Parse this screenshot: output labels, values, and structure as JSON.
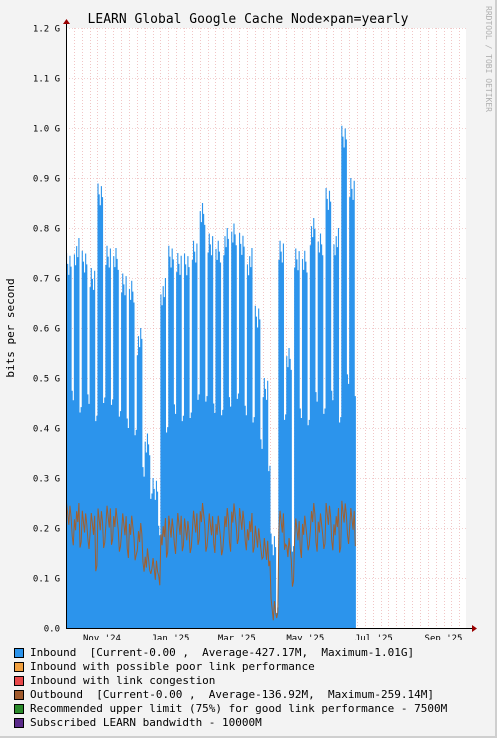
{
  "chart_data": {
    "type": "area",
    "title": "LEARN Global Google Cache Node×pan=yearly",
    "ylabel": "bits per second",
    "watermark": "RRDTOOL / TOBI OETIKER",
    "ylim": [
      0,
      1.2
    ],
    "yunit": "G",
    "y_ticks": [
      {
        "value": 0.0,
        "label": "0.0"
      },
      {
        "value": 0.1,
        "label": "0.1 G"
      },
      {
        "value": 0.2,
        "label": "0.2 G"
      },
      {
        "value": 0.3,
        "label": "0.3 G"
      },
      {
        "value": 0.4,
        "label": "0.4 G"
      },
      {
        "value": 0.5,
        "label": "0.5 G"
      },
      {
        "value": 0.6,
        "label": "0.6 G"
      },
      {
        "value": 0.7,
        "label": "0.7 G"
      },
      {
        "value": 0.8,
        "label": "0.8 G"
      },
      {
        "value": 0.9,
        "label": "0.9 G"
      },
      {
        "value": 1.0,
        "label": "1.0 G"
      },
      {
        "value": 1.1,
        "label": "1.1 G"
      },
      {
        "value": 1.2,
        "label": "1.2 G"
      }
    ],
    "xlim": [
      "2024-10-14",
      "2025-10-05"
    ],
    "x_ticks": [
      {
        "date": "2024-11-15",
        "label": "Nov '24"
      },
      {
        "date": "2025-01-15",
        "label": "Jan '25"
      },
      {
        "date": "2025-03-15",
        "label": "Mar '25"
      },
      {
        "date": "2025-05-15",
        "label": "May '25"
      },
      {
        "date": "2025-07-15",
        "label": "Jul '25"
      },
      {
        "date": "2025-09-15",
        "label": "Sep '25"
      }
    ],
    "inbound_weekly": [
      {
        "week_start": "2024-10-14",
        "weekday_max": 0.75,
        "weekend_min": 0.45
      },
      {
        "week_start": "2024-10-21",
        "weekday_max": 0.78,
        "weekend_min": 0.42
      },
      {
        "week_start": "2024-10-28",
        "weekday_max": 0.76,
        "weekend_min": 0.44
      },
      {
        "week_start": "2024-11-04",
        "weekday_max": 0.72,
        "weekend_min": 0.4
      },
      {
        "week_start": "2024-11-11",
        "weekday_max": 0.9,
        "weekend_min": 0.45
      },
      {
        "week_start": "2024-11-18",
        "weekday_max": 0.77,
        "weekend_min": 0.43
      },
      {
        "week_start": "2024-11-25",
        "weekday_max": 0.76,
        "weekend_min": 0.42
      },
      {
        "week_start": "2024-12-02",
        "weekday_max": 0.72,
        "weekend_min": 0.4
      },
      {
        "week_start": "2024-12-09",
        "weekday_max": 0.7,
        "weekend_min": 0.38
      },
      {
        "week_start": "2024-12-16",
        "weekday_max": 0.6,
        "weekend_min": 0.3
      },
      {
        "week_start": "2024-12-23",
        "weekday_max": 0.4,
        "weekend_min": 0.25
      },
      {
        "week_start": "2024-12-30",
        "weekday_max": 0.3,
        "weekend_min": 0.18
      },
      {
        "week_start": "2025-01-06",
        "weekday_max": 0.7,
        "weekend_min": 0.38
      },
      {
        "week_start": "2025-01-13",
        "weekday_max": 0.77,
        "weekend_min": 0.42
      },
      {
        "week_start": "2025-01-20",
        "weekday_max": 0.75,
        "weekend_min": 0.4
      },
      {
        "week_start": "2025-01-27",
        "weekday_max": 0.76,
        "weekend_min": 0.42
      },
      {
        "week_start": "2025-02-03",
        "weekday_max": 0.78,
        "weekend_min": 0.44
      },
      {
        "week_start": "2025-02-10",
        "weekday_max": 0.85,
        "weekend_min": 0.45
      },
      {
        "week_start": "2025-02-17",
        "weekday_max": 0.8,
        "weekend_min": 0.43
      },
      {
        "week_start": "2025-02-24",
        "weekday_max": 0.78,
        "weekend_min": 0.42
      },
      {
        "week_start": "2025-03-03",
        "weekday_max": 0.8,
        "weekend_min": 0.44
      },
      {
        "week_start": "2025-03-10",
        "weekday_max": 0.82,
        "weekend_min": 0.45
      },
      {
        "week_start": "2025-03-17",
        "weekday_max": 0.79,
        "weekend_min": 0.42
      },
      {
        "week_start": "2025-03-24",
        "weekday_max": 0.76,
        "weekend_min": 0.4
      },
      {
        "week_start": "2025-03-31",
        "weekday_max": 0.65,
        "weekend_min": 0.35
      },
      {
        "week_start": "2025-04-07",
        "weekday_max": 0.5,
        "weekend_min": 0.3
      },
      {
        "week_start": "2025-04-14",
        "weekday_max": 0.2,
        "weekend_min": 0.03
      },
      {
        "week_start": "2025-04-21",
        "weekday_max": 0.78,
        "weekend_min": 0.4
      },
      {
        "week_start": "2025-04-28",
        "weekday_max": 0.56,
        "weekend_min": 0.15
      },
      {
        "week_start": "2025-05-05",
        "weekday_max": 0.77,
        "weekend_min": 0.42
      },
      {
        "week_start": "2025-05-12",
        "weekday_max": 0.76,
        "weekend_min": 0.4
      },
      {
        "week_start": "2025-05-19",
        "weekday_max": 0.82,
        "weekend_min": 0.45
      },
      {
        "week_start": "2025-05-26",
        "weekday_max": 0.8,
        "weekend_min": 0.42
      },
      {
        "week_start": "2025-06-02",
        "weekday_max": 0.88,
        "weekend_min": 0.45
      },
      {
        "week_start": "2025-06-09",
        "weekday_max": 0.8,
        "weekend_min": 0.4
      },
      {
        "week_start": "2025-06-16",
        "weekday_max": 1.01,
        "weekend_min": 0.48
      },
      {
        "week_start": "2025-06-23",
        "weekday_max": 0.9,
        "weekend_min": 0.45
      }
    ],
    "inbound_end": "2025-06-28",
    "outbound_weekly": [
      {
        "week_start": "2024-10-14",
        "peak": 0.25,
        "low": 0.16
      },
      {
        "week_start": "2024-10-21",
        "peak": 0.25,
        "low": 0.15
      },
      {
        "week_start": "2024-10-28",
        "peak": 0.24,
        "low": 0.15
      },
      {
        "week_start": "2024-11-04",
        "peak": 0.23,
        "low": 0.1
      },
      {
        "week_start": "2024-11-11",
        "peak": 0.25,
        "low": 0.16
      },
      {
        "week_start": "2024-11-18",
        "peak": 0.25,
        "low": 0.15
      },
      {
        "week_start": "2024-11-25",
        "peak": 0.24,
        "low": 0.15
      },
      {
        "week_start": "2024-12-02",
        "peak": 0.24,
        "low": 0.14
      },
      {
        "week_start": "2024-12-09",
        "peak": 0.23,
        "low": 0.13
      },
      {
        "week_start": "2024-12-16",
        "peak": 0.21,
        "low": 0.11
      },
      {
        "week_start": "2024-12-23",
        "peak": 0.17,
        "low": 0.1
      },
      {
        "week_start": "2024-12-30",
        "peak": 0.14,
        "low": 0.08
      },
      {
        "week_start": "2025-01-06",
        "peak": 0.22,
        "low": 0.13
      },
      {
        "week_start": "2025-01-13",
        "peak": 0.23,
        "low": 0.14
      },
      {
        "week_start": "2025-01-20",
        "peak": 0.23,
        "low": 0.14
      },
      {
        "week_start": "2025-01-27",
        "peak": 0.23,
        "low": 0.15
      },
      {
        "week_start": "2025-02-03",
        "peak": 0.24,
        "low": 0.15
      },
      {
        "week_start": "2025-02-10",
        "peak": 0.25,
        "low": 0.15
      },
      {
        "week_start": "2025-02-17",
        "peak": 0.24,
        "low": 0.15
      },
      {
        "week_start": "2025-02-24",
        "peak": 0.23,
        "low": 0.14
      },
      {
        "week_start": "2025-03-03",
        "peak": 0.24,
        "low": 0.15
      },
      {
        "week_start": "2025-03-10",
        "peak": 0.26,
        "low": 0.16
      },
      {
        "week_start": "2025-03-17",
        "peak": 0.24,
        "low": 0.15
      },
      {
        "week_start": "2025-03-24",
        "peak": 0.23,
        "low": 0.14
      },
      {
        "week_start": "2025-03-31",
        "peak": 0.21,
        "low": 0.13
      },
      {
        "week_start": "2025-04-07",
        "peak": 0.18,
        "low": 0.11
      },
      {
        "week_start": "2025-04-14",
        "peak": 0.07,
        "low": 0.02
      },
      {
        "week_start": "2025-04-21",
        "peak": 0.24,
        "low": 0.14
      },
      {
        "week_start": "2025-04-28",
        "peak": 0.18,
        "low": 0.08
      },
      {
        "week_start": "2025-05-05",
        "peak": 0.23,
        "low": 0.14
      },
      {
        "week_start": "2025-05-12",
        "peak": 0.23,
        "low": 0.15
      },
      {
        "week_start": "2025-05-19",
        "peak": 0.25,
        "low": 0.15
      },
      {
        "week_start": "2025-05-26",
        "peak": 0.24,
        "low": 0.15
      },
      {
        "week_start": "2025-06-02",
        "peak": 0.25,
        "low": 0.15
      },
      {
        "week_start": "2025-06-09",
        "peak": 0.24,
        "low": 0.14
      },
      {
        "week_start": "2025-06-16",
        "peak": 0.26,
        "low": 0.16
      },
      {
        "week_start": "2025-06-23",
        "peak": 0.24,
        "low": 0.15
      }
    ],
    "colors": {
      "background": "#f3f3f3",
      "plot_background": "#ffffff",
      "inbound": "#2c94ec",
      "outbound": "#a06030",
      "grid": "#e8a0a0",
      "axis": "#000000",
      "arrow": "#990000"
    }
  },
  "legend": [
    {
      "label": "Inbound  [Current-0.00 ,  Average-427.17M,  Maximum-1.01G]",
      "color": "#2c94ec"
    },
    {
      "label": "Inbound with possible poor link performance",
      "color": "#f0a040"
    },
    {
      "label": "Inbound with link congestion",
      "color": "#e8484a"
    },
    {
      "label": "Outbound  [Current-0.00 ,  Average-136.92M,  Maximum-259.14M]",
      "color": "#a05a2c"
    },
    {
      "label": "Recommended upper limit (75%) for good link performance - 7500M",
      "color": "#2a8a2a"
    },
    {
      "label": "Subscribed LEARN bandwidth - 10000M",
      "color": "#5a2a8a"
    }
  ]
}
